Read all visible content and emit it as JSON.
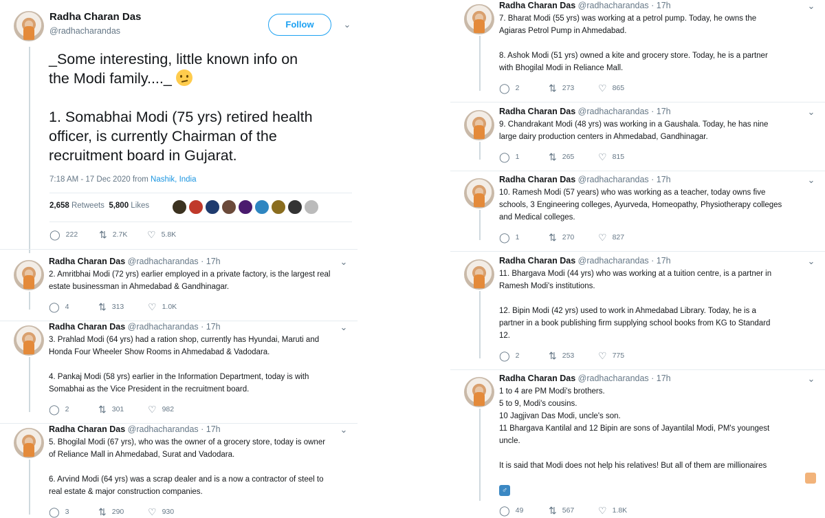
{
  "main_tweet": {
    "name": "Radha Charan Das",
    "handle": "@radhacharandas",
    "follow_label": "Follow",
    "text_line1": "_Some interesting, little known info on",
    "text_line2": "the Modi family...._",
    "text_line3": "1. Somabhai Modi (75 yrs) retired health",
    "text_line4": "officer, is currently Chairman of the",
    "text_line5": "recruitment board in Gujarat.",
    "timestamp": "7:18 AM - 17 Dec 2020 from ",
    "location": "Nashik, India",
    "retweets_count": "2,658",
    "retweets_label": "Retweets",
    "likes_count": "5,800",
    "likes_label": "Likes",
    "replies": "222",
    "retweets": "2.7K",
    "likes": "5.8K"
  },
  "replies": [
    {
      "name": "Radha Charan Das",
      "handle": "@radhacharandas · 17h",
      "lines": [
        "2. Amritbhai Modi (72 yrs) earlier employed in a private factory, is the largest real",
        "estate businessman in Ahmedabad & Gandhinagar."
      ],
      "replies": "4",
      "retweets": "313",
      "likes": "1.0K"
    },
    {
      "name": "Radha Charan Das",
      "handle": "@radhacharandas · 17h",
      "lines": [
        "3. Prahlad Modi (64 yrs) had a ration shop, currently has Hyundai, Maruti and",
        "Honda Four Wheeler Show Rooms in Ahmedabad & Vadodara.",
        "",
        "4. Pankaj Modi (58 yrs) earlier in the Information Department, today is with",
        "Somabhai as the Vice President in the recruitment board."
      ],
      "replies": "2",
      "retweets": "301",
      "likes": "982"
    },
    {
      "name": "Radha Charan Das",
      "handle": "@radhacharandas · 17h",
      "lines": [
        "5. Bhogilal Modi (67 yrs), who was the owner of a grocery store, today is owner",
        "of Reliance Mall in Ahmedabad, Surat and Vadodara.",
        "",
        "6. Arvind Modi (64 yrs) was a scrap dealer and is a now a contractor of steel to",
        "real estate & major construction companies."
      ],
      "replies": "3",
      "retweets": "290",
      "likes": "930"
    },
    {
      "name": "Radha Charan Das",
      "handle": "@radhacharandas · 17h",
      "lines": [
        "7. Bharat Modi (55 yrs) was working at a petrol pump. Today, he owns the",
        "Agiaras Petrol Pump in Ahmedabad.",
        "",
        "8. Ashok Modi (51 yrs) owned a kite and grocery store. Today, he is a partner",
        "with Bhogilal Modi in Reliance Mall."
      ],
      "replies": "2",
      "retweets": "273",
      "likes": "865"
    },
    {
      "name": "Radha Charan Das",
      "handle": "@radhacharandas · 17h",
      "lines": [
        "9. Chandrakant Modi (48 yrs) was working in a Gaushala. Today, he has nine",
        "large dairy production centers in Ahmedabad, Gandhinagar."
      ],
      "replies": "1",
      "retweets": "265",
      "likes": "815"
    },
    {
      "name": "Radha Charan Das",
      "handle": "@radhacharandas · 17h",
      "lines": [
        "10. Ramesh Modi (57 years) who was working as a teacher, today owns five",
        "schools, 3 Engineering colleges, Ayurveda, Homeopathy, Physiotherapy colleges",
        "and Medical colleges."
      ],
      "replies": "1",
      "retweets": "270",
      "likes": "827"
    },
    {
      "name": "Radha Charan Das",
      "handle": "@radhacharandas · 17h",
      "lines": [
        "11. Bhargava Modi (44 yrs) who was working at a tuition centre, is a partner in",
        "Ramesh Modi's institutions.",
        "",
        "12. Bipin Modi (42 yrs) used to work in Ahmedabad Library. Today, he is a",
        "partner in a book publishing firm supplying school books from KG to Standard",
        "12."
      ],
      "replies": "2",
      "retweets": "253",
      "likes": "775"
    },
    {
      "name": "Radha Charan Das",
      "handle": "@radhacharandas · 17h",
      "lines": [
        "1 to 4 are PM Modi's brothers.",
        "5 to 9, Modi's cousins.",
        "10 Jagjivan Das Modi, uncle's son.",
        "11 Bhargava Kantilal and 12 Bipin are sons of Jayantilal Modi, PM's youngest",
        "uncle.",
        "",
        "It is said that Modi does not help his relatives! But all of them are millionaires"
      ],
      "replies": "49",
      "retweets": "567",
      "likes": "1.8K"
    }
  ],
  "icons": {
    "reply": "speech-bubble-icon",
    "retweet": "retweet-arrows-icon",
    "like": "heart-icon",
    "more": "chevron-down-icon"
  },
  "colors": {
    "link": "#1b95e0",
    "muted": "#657786",
    "follow": "#1da1f2"
  }
}
